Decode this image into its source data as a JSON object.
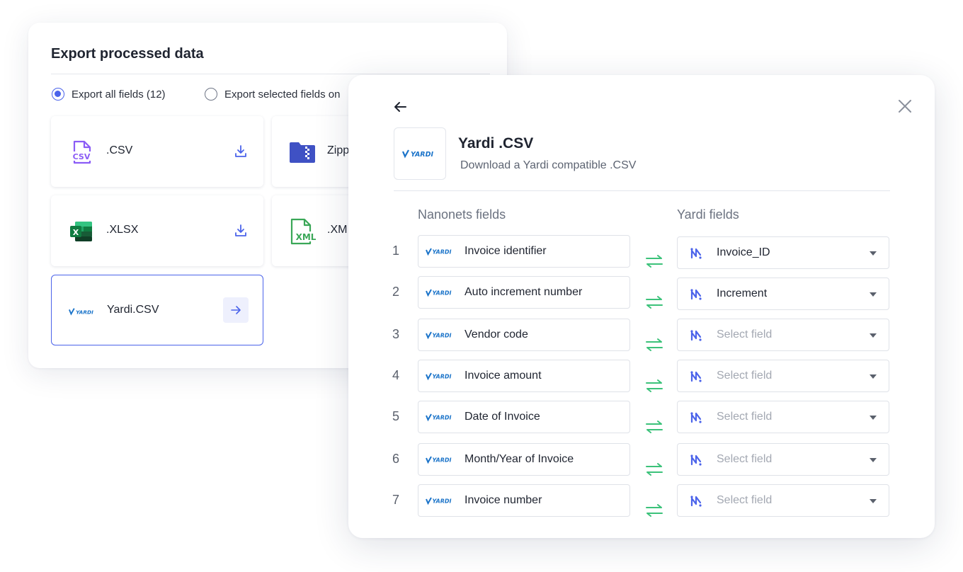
{
  "export_panel": {
    "title": "Export processed data",
    "radio_all": "Export all fields (12)",
    "radio_selected": "Export selected fields on",
    "formats": [
      {
        "label": ".CSV",
        "icon": "csv-file-icon"
      },
      {
        "label": "Zipp",
        "icon": "zip-folder-icon"
      },
      {
        "label": ".XLSX",
        "icon": "excel-icon"
      },
      {
        "label": ".XM",
        "icon": "xml-file-icon"
      },
      {
        "label": "Yardi.CSV",
        "icon": "yardi-logo"
      }
    ],
    "csv_icon_text": "CSV",
    "xml_icon_text": "XML",
    "xlsx_icon_text": "X"
  },
  "modal": {
    "title": "Yardi .CSV",
    "subtitle": "Download a Yardi compatible .CSV",
    "logo_text": "YARDI",
    "left_column_header": "Nanonets fields",
    "right_column_header": "Yardi fields",
    "rows": [
      {
        "num": "1",
        "source": "Invoice identifier",
        "target": "Invoice_ID",
        "selected": true
      },
      {
        "num": "2",
        "source": "Auto increment number",
        "target": "Increment",
        "selected": true
      },
      {
        "num": "3",
        "source": "Vendor code",
        "target": "Select field",
        "selected": false
      },
      {
        "num": "4",
        "source": "Invoice amount",
        "target": "Select field",
        "selected": false
      },
      {
        "num": "5",
        "source": "Date of Invoice",
        "target": "Select field",
        "selected": false
      },
      {
        "num": "6",
        "source": "Month/Year of Invoice",
        "target": "Select field",
        "selected": false
      },
      {
        "num": "7",
        "source": "Invoice number",
        "target": "Select field",
        "selected": false
      }
    ]
  },
  "colors": {
    "accent": "#4b63ea",
    "swap_green": "#3cc27a",
    "yardi_blue": "#1a73c9",
    "csv_purple": "#8b5cf6",
    "excel_green": "#1e7e45",
    "xml_green": "#3aa757",
    "zip_blue": "#3f51c4"
  }
}
